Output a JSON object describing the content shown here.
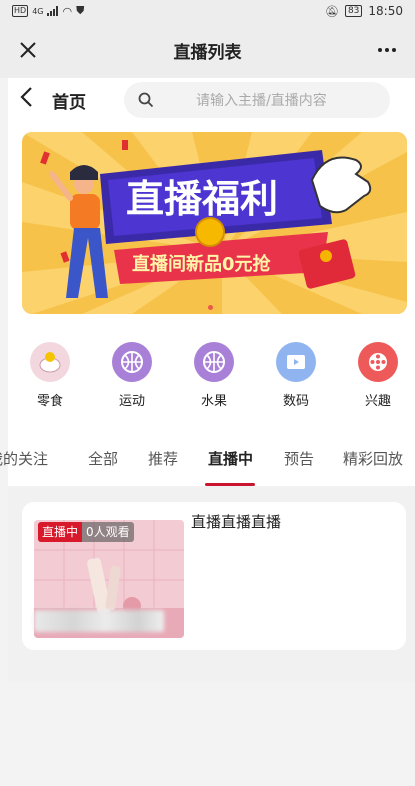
{
  "status": {
    "left_box": "HD",
    "left_mini": "4G",
    "time": "18:50",
    "battery": "83"
  },
  "header": {
    "title": "直播列表"
  },
  "nav": {
    "home_label": "首页",
    "search_placeholder": "请输入主播/直播内容"
  },
  "banner": {
    "headline": "直播福利",
    "subline": "直播间新品0元抢"
  },
  "categories": [
    {
      "label": "零食",
      "icon": "snack-icon"
    },
    {
      "label": "运动",
      "icon": "basketball-icon"
    },
    {
      "label": "水果",
      "icon": "basketball-icon"
    },
    {
      "label": "数码",
      "icon": "video-icon"
    },
    {
      "label": "兴趣",
      "icon": "film-reel-icon"
    }
  ],
  "tabs": [
    {
      "label": "我的关注"
    },
    {
      "label": "全部"
    },
    {
      "label": "推荐"
    },
    {
      "label": "直播中",
      "active": true
    },
    {
      "label": "预告"
    },
    {
      "label": "精彩回放"
    }
  ],
  "card": {
    "live_badge": "直播中",
    "viewers": "0人观看",
    "title": "直播直播直播"
  },
  "colors": {
    "accent": "#c9152f",
    "banner_bg": "#f6c24a",
    "badge_red": "#d7192b"
  }
}
